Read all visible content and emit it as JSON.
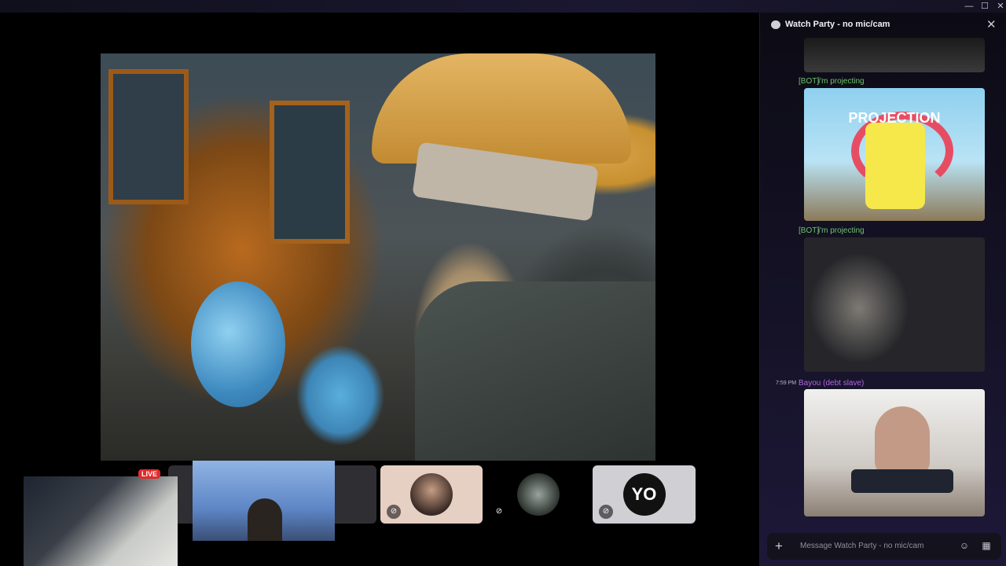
{
  "window": {
    "minimize": "—",
    "maximize": "☐",
    "close": "✕"
  },
  "sidebar": {
    "title": "Watch Party - no mic/cam",
    "close_label": "✕",
    "messages": [
      {
        "author": "[BOT]",
        "text": "i'm projecting"
      },
      {
        "author": "[BOT]",
        "text": "i'm projecting"
      },
      {
        "time": "7:59 PM",
        "author": "Bayou (debt slave)"
      }
    ],
    "meme_text": "PROJECTION",
    "composer_placeholder": "Message Watch Party - no mic/cam"
  },
  "stream": {
    "live_badge": "LIVE"
  },
  "participants": [
    {
      "label": "YO"
    }
  ],
  "colors": {
    "bot": "#6ec36b",
    "user": "#b166e0",
    "live": "#e02a2a"
  }
}
